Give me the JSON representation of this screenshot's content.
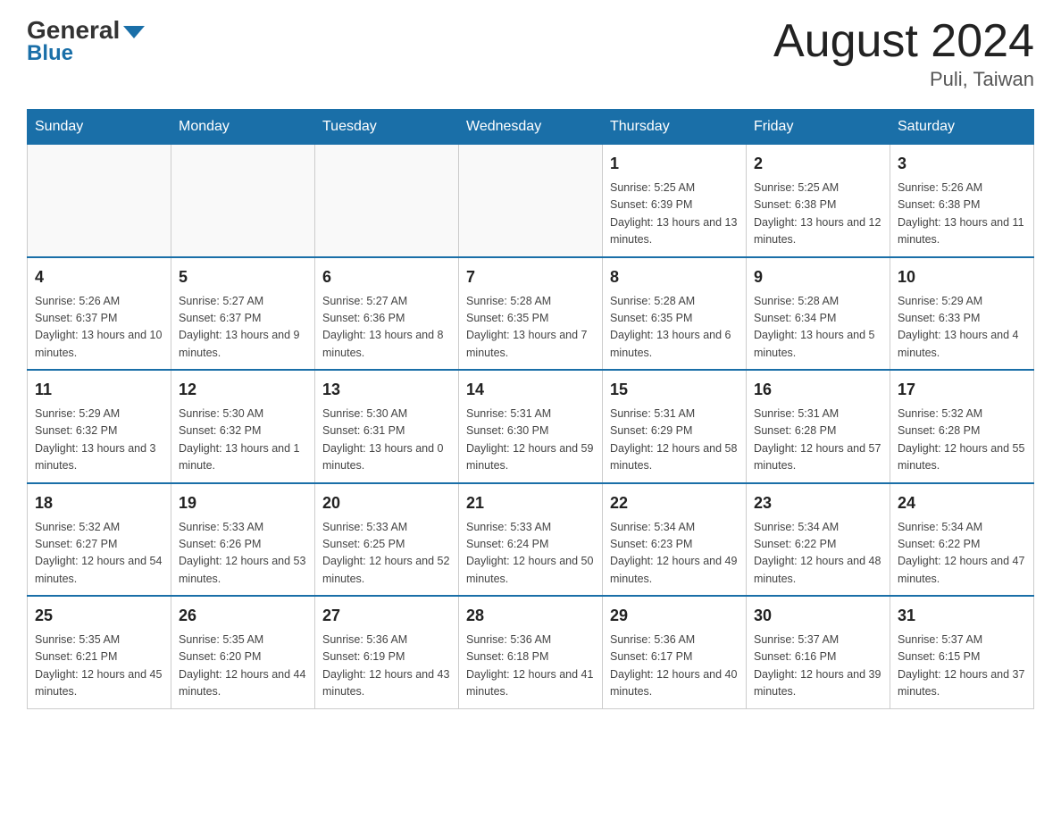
{
  "header": {
    "logo_line1": "General",
    "logo_line2": "Blue",
    "title": "August 2024",
    "subtitle": "Puli, Taiwan"
  },
  "days_of_week": [
    "Sunday",
    "Monday",
    "Tuesday",
    "Wednesday",
    "Thursday",
    "Friday",
    "Saturday"
  ],
  "weeks": [
    [
      {
        "day": "",
        "info": ""
      },
      {
        "day": "",
        "info": ""
      },
      {
        "day": "",
        "info": ""
      },
      {
        "day": "",
        "info": ""
      },
      {
        "day": "1",
        "info": "Sunrise: 5:25 AM\nSunset: 6:39 PM\nDaylight: 13 hours and 13 minutes."
      },
      {
        "day": "2",
        "info": "Sunrise: 5:25 AM\nSunset: 6:38 PM\nDaylight: 13 hours and 12 minutes."
      },
      {
        "day": "3",
        "info": "Sunrise: 5:26 AM\nSunset: 6:38 PM\nDaylight: 13 hours and 11 minutes."
      }
    ],
    [
      {
        "day": "4",
        "info": "Sunrise: 5:26 AM\nSunset: 6:37 PM\nDaylight: 13 hours and 10 minutes."
      },
      {
        "day": "5",
        "info": "Sunrise: 5:27 AM\nSunset: 6:37 PM\nDaylight: 13 hours and 9 minutes."
      },
      {
        "day": "6",
        "info": "Sunrise: 5:27 AM\nSunset: 6:36 PM\nDaylight: 13 hours and 8 minutes."
      },
      {
        "day": "7",
        "info": "Sunrise: 5:28 AM\nSunset: 6:35 PM\nDaylight: 13 hours and 7 minutes."
      },
      {
        "day": "8",
        "info": "Sunrise: 5:28 AM\nSunset: 6:35 PM\nDaylight: 13 hours and 6 minutes."
      },
      {
        "day": "9",
        "info": "Sunrise: 5:28 AM\nSunset: 6:34 PM\nDaylight: 13 hours and 5 minutes."
      },
      {
        "day": "10",
        "info": "Sunrise: 5:29 AM\nSunset: 6:33 PM\nDaylight: 13 hours and 4 minutes."
      }
    ],
    [
      {
        "day": "11",
        "info": "Sunrise: 5:29 AM\nSunset: 6:32 PM\nDaylight: 13 hours and 3 minutes."
      },
      {
        "day": "12",
        "info": "Sunrise: 5:30 AM\nSunset: 6:32 PM\nDaylight: 13 hours and 1 minute."
      },
      {
        "day": "13",
        "info": "Sunrise: 5:30 AM\nSunset: 6:31 PM\nDaylight: 13 hours and 0 minutes."
      },
      {
        "day": "14",
        "info": "Sunrise: 5:31 AM\nSunset: 6:30 PM\nDaylight: 12 hours and 59 minutes."
      },
      {
        "day": "15",
        "info": "Sunrise: 5:31 AM\nSunset: 6:29 PM\nDaylight: 12 hours and 58 minutes."
      },
      {
        "day": "16",
        "info": "Sunrise: 5:31 AM\nSunset: 6:28 PM\nDaylight: 12 hours and 57 minutes."
      },
      {
        "day": "17",
        "info": "Sunrise: 5:32 AM\nSunset: 6:28 PM\nDaylight: 12 hours and 55 minutes."
      }
    ],
    [
      {
        "day": "18",
        "info": "Sunrise: 5:32 AM\nSunset: 6:27 PM\nDaylight: 12 hours and 54 minutes."
      },
      {
        "day": "19",
        "info": "Sunrise: 5:33 AM\nSunset: 6:26 PM\nDaylight: 12 hours and 53 minutes."
      },
      {
        "day": "20",
        "info": "Sunrise: 5:33 AM\nSunset: 6:25 PM\nDaylight: 12 hours and 52 minutes."
      },
      {
        "day": "21",
        "info": "Sunrise: 5:33 AM\nSunset: 6:24 PM\nDaylight: 12 hours and 50 minutes."
      },
      {
        "day": "22",
        "info": "Sunrise: 5:34 AM\nSunset: 6:23 PM\nDaylight: 12 hours and 49 minutes."
      },
      {
        "day": "23",
        "info": "Sunrise: 5:34 AM\nSunset: 6:22 PM\nDaylight: 12 hours and 48 minutes."
      },
      {
        "day": "24",
        "info": "Sunrise: 5:34 AM\nSunset: 6:22 PM\nDaylight: 12 hours and 47 minutes."
      }
    ],
    [
      {
        "day": "25",
        "info": "Sunrise: 5:35 AM\nSunset: 6:21 PM\nDaylight: 12 hours and 45 minutes."
      },
      {
        "day": "26",
        "info": "Sunrise: 5:35 AM\nSunset: 6:20 PM\nDaylight: 12 hours and 44 minutes."
      },
      {
        "day": "27",
        "info": "Sunrise: 5:36 AM\nSunset: 6:19 PM\nDaylight: 12 hours and 43 minutes."
      },
      {
        "day": "28",
        "info": "Sunrise: 5:36 AM\nSunset: 6:18 PM\nDaylight: 12 hours and 41 minutes."
      },
      {
        "day": "29",
        "info": "Sunrise: 5:36 AM\nSunset: 6:17 PM\nDaylight: 12 hours and 40 minutes."
      },
      {
        "day": "30",
        "info": "Sunrise: 5:37 AM\nSunset: 6:16 PM\nDaylight: 12 hours and 39 minutes."
      },
      {
        "day": "31",
        "info": "Sunrise: 5:37 AM\nSunset: 6:15 PM\nDaylight: 12 hours and 37 minutes."
      }
    ]
  ]
}
